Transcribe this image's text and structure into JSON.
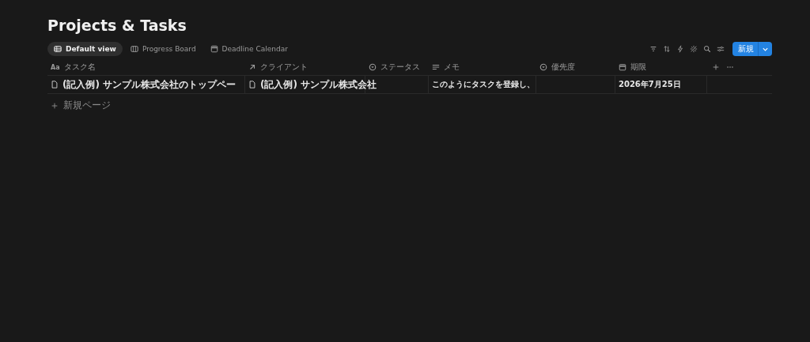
{
  "title": "Projects & Tasks",
  "views": [
    {
      "label": "Default view",
      "kind": "table",
      "selected": true
    },
    {
      "label": "Progress Board",
      "kind": "board",
      "selected": false
    },
    {
      "label": "Deadline Calendar",
      "kind": "calendar",
      "selected": false
    }
  ],
  "new_button": {
    "label": "新規"
  },
  "table": {
    "columns": [
      {
        "label": "タスク名",
        "kind": "title",
        "icon_text": "Aa"
      },
      {
        "label": "クライアント",
        "kind": "relation"
      },
      {
        "label": "ステータス",
        "kind": "status"
      },
      {
        "label": "メモ",
        "kind": "text"
      },
      {
        "label": "優先度",
        "kind": "status"
      },
      {
        "label": "期限",
        "kind": "date"
      }
    ],
    "rows": [
      [
        "(記入例) サンプル株式会社のトップペー",
        "(記入例) サンプル株式会社",
        "",
        "このようにタスクを登録し、",
        "",
        "2026年7月25日"
      ]
    ],
    "new_row": "新規ページ"
  }
}
